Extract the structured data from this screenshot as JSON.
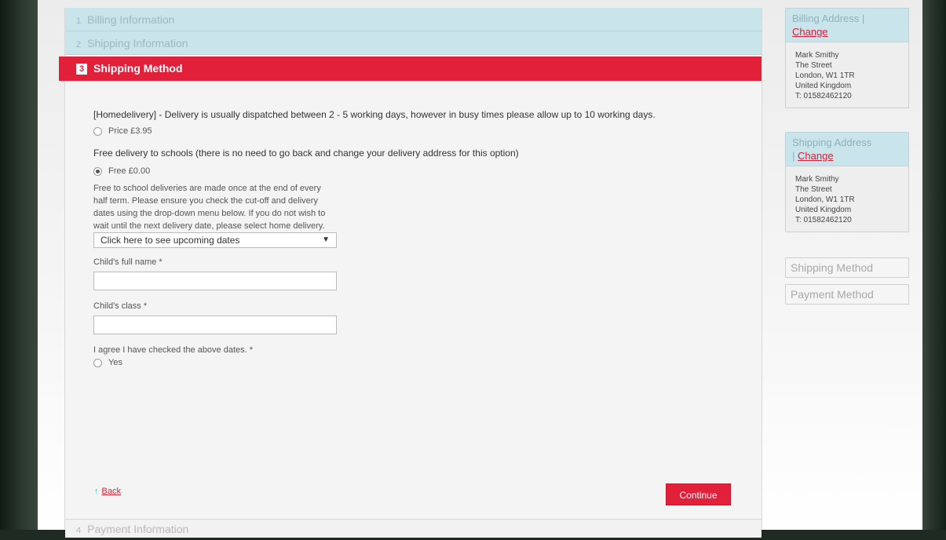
{
  "steps": {
    "billing": {
      "num": "1",
      "label": "Billing Information"
    },
    "shipping": {
      "num": "2",
      "label": "Shipping Information"
    },
    "method": {
      "num": "3",
      "label": "Shipping Method"
    },
    "payment": {
      "num": "4",
      "label": "Payment Information"
    }
  },
  "shipping_method": {
    "home_desc": "[Homedelivery] - Delivery is usually dispatched between 2 - 5 working days, however in busy times please allow up to 10 working days.",
    "home_price": "Price £3.95",
    "school_desc": "Free delivery to schools (there is no need to go back and change your delivery address for this option)",
    "school_price": "Free £0.00",
    "school_note": "Free to school deliveries are made once at the end of every half term. Please ensure you check the cut-off and delivery dates using the drop-down menu below. If you do not wish to wait until the next delivery date, please select home delivery.",
    "dates_select": "Click here to see upcoming dates",
    "child_name_label": "Child's full name *",
    "child_class_label": "Child's class *",
    "agree_label": "I agree I have checked the above dates. *",
    "agree_option": "Yes",
    "back_label": "Back",
    "continue_label": "Continue"
  },
  "sidebar": {
    "billing_title": "Billing Address",
    "billing_sep": "|",
    "billing_change": "Change",
    "billing_lines": [
      "Mark Smithy",
      "The Street",
      "London, W1 1TR",
      "United Kingdom",
      "T: 01582462120"
    ],
    "shipping_title": "Shipping Address",
    "shipping_sep": "|",
    "shipping_change": "Change",
    "shipping_lines": [
      "Mark Smithy",
      "The Street",
      "London, W1 1TR",
      "United Kingdom",
      "T: 01582462120"
    ],
    "shipping_method": "Shipping Method",
    "payment_method": "Payment Method"
  },
  "colors": {
    "accent": "#e2203a",
    "step_bg": "#c9e4ea"
  }
}
